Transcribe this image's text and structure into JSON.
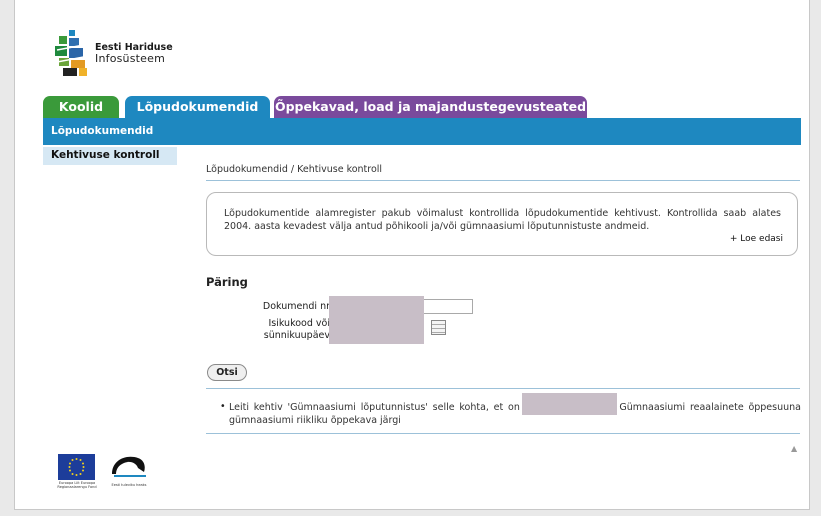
{
  "logo": {
    "line1": "Eesti Hariduse",
    "line2": "Infosüsteem"
  },
  "tabs": [
    {
      "label": "Koolid"
    },
    {
      "label": "Lõpudokumendid"
    },
    {
      "label": "Õppekavad, load ja majandustegevusteated"
    }
  ],
  "section_bar": "Lõpudokumendid",
  "left_nav": {
    "items": [
      {
        "label": "Kehtivuse kontroll"
      }
    ]
  },
  "breadcrumb": "Lõpudokumendid / Kehtivuse kontroll",
  "info": {
    "text": "Lõpudokumentide alamregister pakub võimalust kontrollida lõpudokumentide kehtivust. Kontrollida saab alates 2004. aasta kevadest välja antud põhikooli ja/või gümnaasiumi lõputunnistuste andmeid.",
    "read_more": "+ Loe edasi"
  },
  "query": {
    "title": "Päring",
    "doc_label": "Dokumendi nr",
    "id_label_1": "Isikukood või",
    "id_label_2": "sünnikuupäev",
    "search_label": "Otsi"
  },
  "result": {
    "text": "Leiti kehtiv 'Gümnaasiumi lõputunnistus' selle kohta, et                               on lõpetanud Nõmme Gümnaasiumi reaalainete õppesuuna gümnaasiumi riikliku õppekava järgi"
  },
  "footer": {
    "eu_caption": "Euroopa Liit Euroopa Regionaalarengu Fond",
    "ee_caption": "Eesti tuleviku heaks"
  },
  "colors": {
    "koolid_tab": "#3a9a3a",
    "lopudokumendid_tab": "#1e88c0",
    "oppekavad_tab": "#7a4a9c",
    "section_bar": "#1e88c0",
    "left_nav": "#d6e8f4"
  }
}
